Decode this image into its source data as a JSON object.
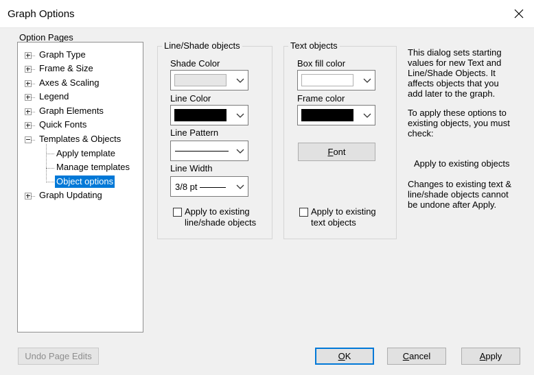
{
  "window": {
    "title": "Graph Options"
  },
  "tree": {
    "label": "Option Pages",
    "items": [
      {
        "label": "Graph Type"
      },
      {
        "label": "Frame & Size"
      },
      {
        "label": "Axes & Scaling"
      },
      {
        "label": "Legend"
      },
      {
        "label": "Graph Elements"
      },
      {
        "label": "Quick Fonts"
      },
      {
        "label": "Templates & Objects"
      },
      {
        "label": "Apply template"
      },
      {
        "label": "Manage templates"
      },
      {
        "label": "Object options"
      },
      {
        "label": "Graph Updating"
      }
    ]
  },
  "line_shade": {
    "group_label": "Line/Shade objects",
    "shade_color_label": "Shade Color",
    "line_color_label": "Line Color",
    "line_pattern_label": "Line Pattern",
    "line_width_label": "Line Width",
    "line_width_value": "3/8 pt",
    "apply_label_1": "Apply to existing",
    "apply_label_2": "line/shade objects",
    "shade_color": "#e6e6e6",
    "line_color": "#000000"
  },
  "text_objects": {
    "group_label": "Text objects",
    "box_fill_label": "Box fill color",
    "frame_color_label": "Frame color",
    "font_button_pre": "",
    "font_button_key": "F",
    "font_button_post": "ont",
    "apply_label_1": "Apply to existing",
    "apply_label_2": "text objects",
    "box_fill_color": "#ffffff",
    "frame_color": "#000000"
  },
  "info": {
    "para1": [
      "This dialog sets starting",
      "values for new Text and",
      "Line/Shade Objects.  It",
      "affects objects that you",
      "add later to the graph."
    ],
    "para2": [
      "To apply these options to",
      "existing objects, you must",
      "check:"
    ],
    "para3": "Apply to existing objects",
    "para4": [
      "Changes to existing text &",
      "line/shade objects cannot",
      "be undone after Apply."
    ]
  },
  "buttons": {
    "undo": "Undo Page Edits",
    "ok_key": "O",
    "ok_rest": "K",
    "cancel_key": "C",
    "cancel_rest": "ancel",
    "apply_pre": "",
    "apply_key": "A",
    "apply_rest": "pply"
  }
}
